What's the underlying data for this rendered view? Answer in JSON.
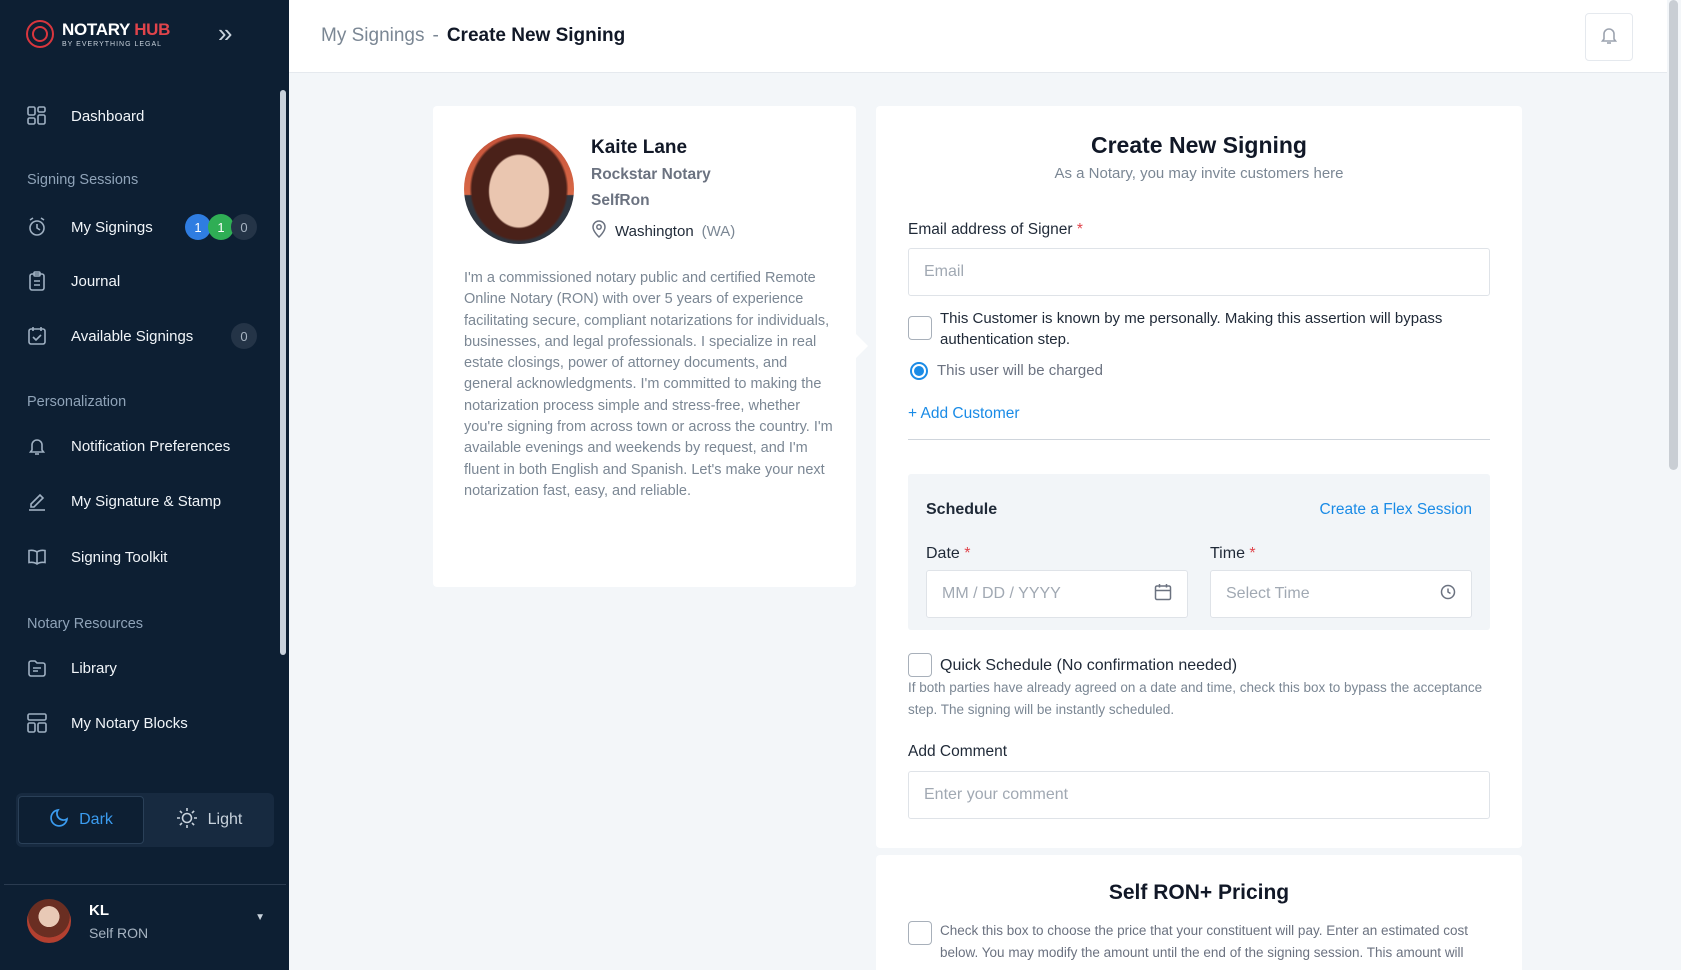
{
  "logo": {
    "main_a": "NOTARY ",
    "main_b": "HUB",
    "sub": "BY EVERYTHING LEGAL"
  },
  "sidebar": {
    "collapse_icon": "double-chevron-right-icon",
    "dashboard": "Dashboard",
    "section_signing": "Signing Sessions",
    "my_signings": "My Signings",
    "my_signings_badges": [
      "1",
      "1",
      "0"
    ],
    "journal": "Journal",
    "available_signings": "Available Signings",
    "available_badge": "0",
    "section_personalization": "Personalization",
    "notification_prefs": "Notification Preferences",
    "signature_stamp": "My Signature & Stamp",
    "signing_toolkit": "Signing Toolkit",
    "section_resources": "Notary Resources",
    "library": "Library",
    "notary_blocks": "My Notary Blocks"
  },
  "theme": {
    "dark": "Dark",
    "light": "Light",
    "active": "dark"
  },
  "user": {
    "initials": "KL",
    "role": "Self RON"
  },
  "header": {
    "breadcrumb_parent": "My Signings",
    "breadcrumb_sep": "-",
    "breadcrumb_current": "Create New Signing"
  },
  "profile": {
    "name": "Kaite Lane",
    "title": "Rockstar Notary",
    "type": "SelfRon",
    "location": "Washington",
    "location_abbr": "(WA)",
    "bio": "I'm a commissioned notary public and certified Remote Online Notary (RON) with over 5 years of experience facilitating secure, compliant notarizations for individuals, businesses, and legal professionals. I specialize in real estate closings, power of attorney documents, and general acknowledgments. I'm committed to making the notarization process simple and stress-free, whether you're signing from across town or across the country. I'm available evenings and weekends by request, and I'm fluent in both English and Spanish. Let's make your next notarization fast, easy, and reliable."
  },
  "form": {
    "title": "Create New Signing",
    "subtitle": "As a Notary, you may invite customers here",
    "email_label": "Email address of Signer",
    "required_mark": "*",
    "email_placeholder": "Email",
    "email_value": "",
    "known_customer_text": "This Customer is known by me personally. Making this assertion will bypass authentication step.",
    "charged_text": "This user will be charged",
    "add_customer": "+ Add Customer",
    "schedule_title": "Schedule",
    "flex_session": "Create a Flex Session",
    "date_label": "Date",
    "date_placeholder": "MM / DD / YYYY",
    "time_label": "Time",
    "time_placeholder": "Select Time",
    "quick_schedule": "Quick Schedule (No confirmation needed)",
    "quick_schedule_hint": "If both parties have already agreed on a date and time, check this box to bypass the acceptance step. The signing will be instantly scheduled.",
    "comment_label": "Add Comment",
    "comment_placeholder": "Enter your comment",
    "comment_value": ""
  },
  "pricing": {
    "title": "Self RON+ Pricing",
    "text": "Check this box to choose the price that your constituent will pay. Enter an estimated cost below. You may modify the amount until the end of the signing session. This amount will"
  },
  "colors": {
    "sidebar_bg": "#0d1f33",
    "accent": "#1a8be6",
    "brand_red": "#e0444b",
    "badge_blue": "#2f7de1",
    "badge_green": "#2fae55"
  }
}
